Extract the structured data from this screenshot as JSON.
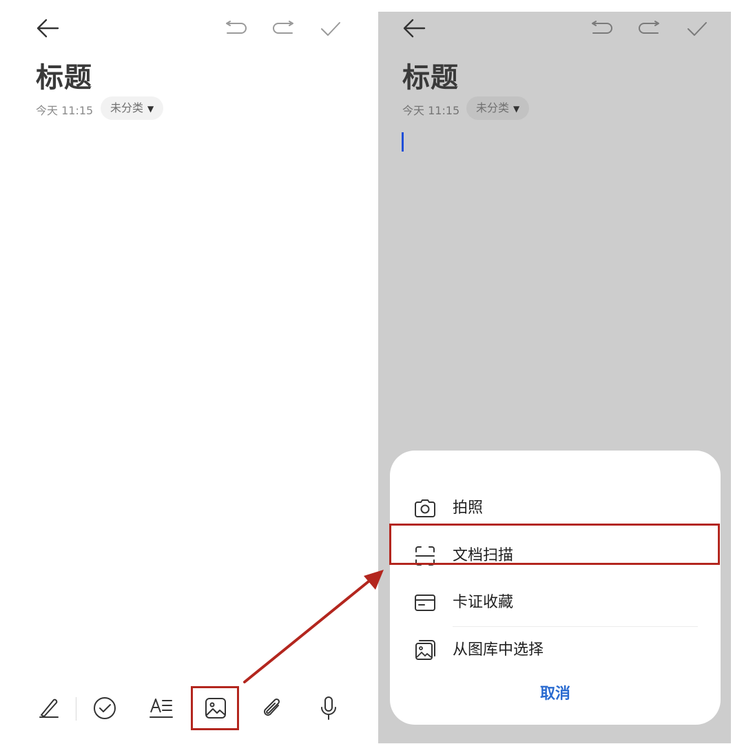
{
  "editor": {
    "title": "标题",
    "date": "今天 11:15",
    "category": "未分类",
    "caret": "▼"
  },
  "toolbar": {
    "icons": [
      "handwriting-icon",
      "checklist-icon",
      "text-format-icon",
      "image-icon",
      "attachment-icon",
      "microphone-icon"
    ],
    "highlighted": "image-icon"
  },
  "sheet": {
    "items": [
      {
        "label": "拍照",
        "icon": "camera-icon"
      },
      {
        "label": "文档扫描",
        "icon": "document-scan-icon"
      },
      {
        "label": "卡证收藏",
        "icon": "card-icon"
      },
      {
        "label": "从图库中选择",
        "icon": "gallery-icon"
      }
    ],
    "cancel": "取消",
    "highlighted": "文档扫描"
  },
  "colors": {
    "accent_blue": "#2a6bd0",
    "highlight_red": "#b3261e",
    "dim_overlay": "#cdcdcd"
  }
}
